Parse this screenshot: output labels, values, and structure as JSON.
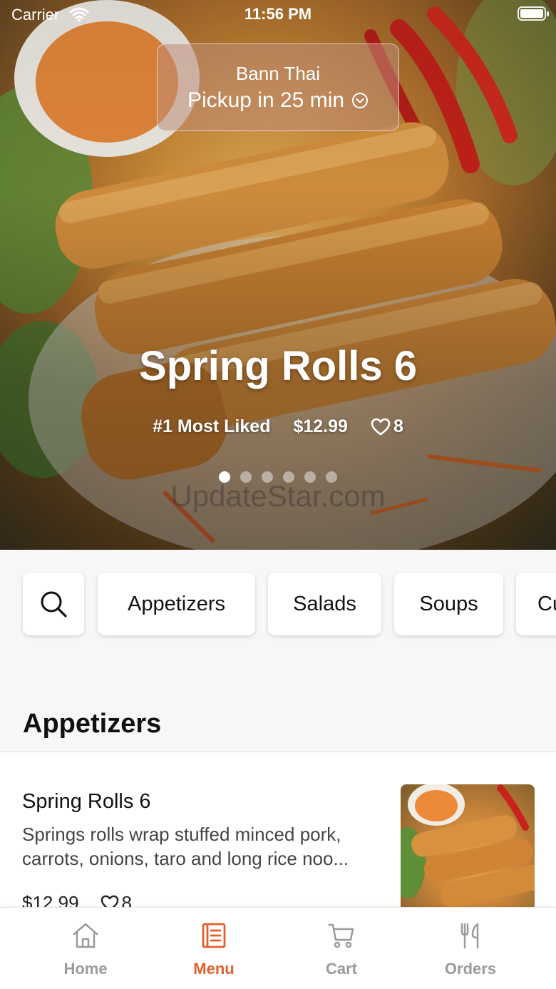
{
  "status_bar": {
    "carrier": "Carrier",
    "time": "11:56 PM"
  },
  "pickup": {
    "restaurant": "Bann Thai",
    "pickup_text": "Pickup in 25 min"
  },
  "hero": {
    "title": "Spring Rolls 6",
    "rank": "#1 Most Liked",
    "price": "$12.99",
    "likes": "8",
    "page_count": 6,
    "active_page": 1,
    "watermark": "UpdateStar.com"
  },
  "categories": {
    "items": [
      "Appetizers",
      "Salads",
      "Soups",
      "Cu"
    ]
  },
  "section": {
    "title": "Appetizers"
  },
  "menu_item": {
    "name": "Spring Rolls 6",
    "description_line1": "Springs rolls wrap stuffed minced pork,",
    "description_line2": "carrots, onions, taro and long rice noo...",
    "price": "$12.99",
    "likes": "8"
  },
  "tabs": [
    {
      "label": "Home",
      "icon": "home-icon",
      "active": false
    },
    {
      "label": "Menu",
      "icon": "menu-icon",
      "active": true
    },
    {
      "label": "Cart",
      "icon": "cart-icon",
      "active": false
    },
    {
      "label": "Orders",
      "icon": "utensils-icon",
      "active": false
    }
  ],
  "colors": {
    "accent": "#e0602b",
    "inactive_tab": "#9a9a9a",
    "background": "#f7f7f7"
  }
}
